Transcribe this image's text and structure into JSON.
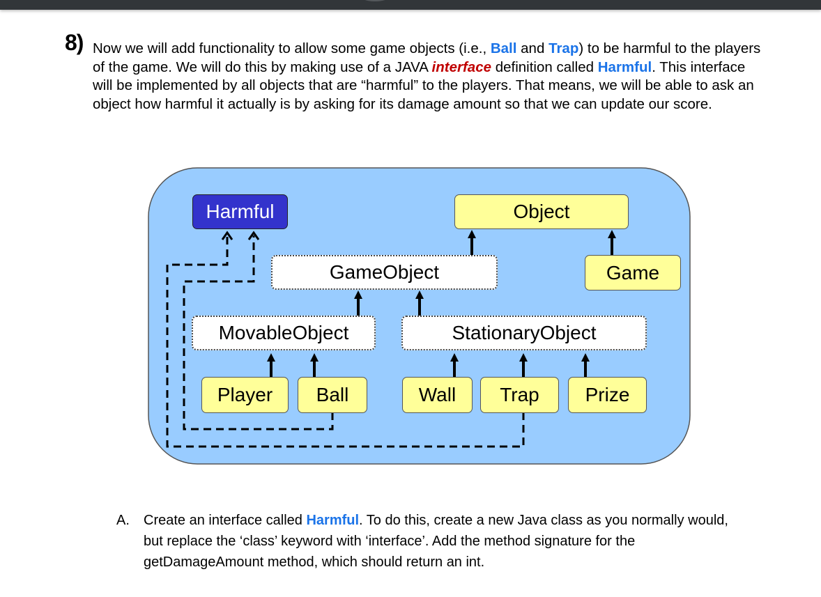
{
  "question": {
    "number": "8)",
    "intro": {
      "t1": "Now we will add functionality to allow some game objects (i.e., ",
      "ball": "Ball",
      "t2": " and ",
      "trap": "Trap",
      "t3": ") to be harmful to the players of the game. We will do this by making use of a JAVA ",
      "interface": "interface",
      "t4": " definition called ",
      "harmful": "Harmful",
      "t5": ". This interface will be implemented by all objects that are “harmful” to the players. That means, we will be able to ask an object how harmful it actually is by asking for its damage amount so that we can update our score."
    }
  },
  "diagram": {
    "colors": {
      "background": "#99ccff",
      "concrete_class": "#ffff99",
      "abstract_class": "#ffffff",
      "interface": "#3333cc"
    },
    "nodes": {
      "harmful": "Harmful",
      "object": "Object",
      "game_object": "GameObject",
      "game": "Game",
      "movable_object": "MovableObject",
      "stationary_object": "StationaryObject",
      "player": "Player",
      "ball": "Ball",
      "wall": "Wall",
      "trap": "Trap",
      "prize": "Prize"
    },
    "edges": [
      {
        "from": "GameObject",
        "to": "Object",
        "type": "extends"
      },
      {
        "from": "Game",
        "to": "Object",
        "type": "extends"
      },
      {
        "from": "MovableObject",
        "to": "GameObject",
        "type": "extends"
      },
      {
        "from": "StationaryObject",
        "to": "GameObject",
        "type": "extends"
      },
      {
        "from": "Player",
        "to": "MovableObject",
        "type": "extends"
      },
      {
        "from": "Ball",
        "to": "MovableObject",
        "type": "extends"
      },
      {
        "from": "Wall",
        "to": "StationaryObject",
        "type": "extends"
      },
      {
        "from": "Trap",
        "to": "StationaryObject",
        "type": "extends"
      },
      {
        "from": "Prize",
        "to": "StationaryObject",
        "type": "extends"
      },
      {
        "from": "Ball",
        "to": "Harmful",
        "type": "implements"
      },
      {
        "from": "Trap",
        "to": "Harmful",
        "type": "implements"
      }
    ]
  },
  "part_a": {
    "marker": "A.",
    "t1": "Create an interface called ",
    "harmful": "Harmful",
    "t2": ".  To do this, create a new Java class as you normally would, but replace the ‘class’ keyword with ‘interface’. Add the method signature for the getDamageAmount method, which should return an int."
  }
}
